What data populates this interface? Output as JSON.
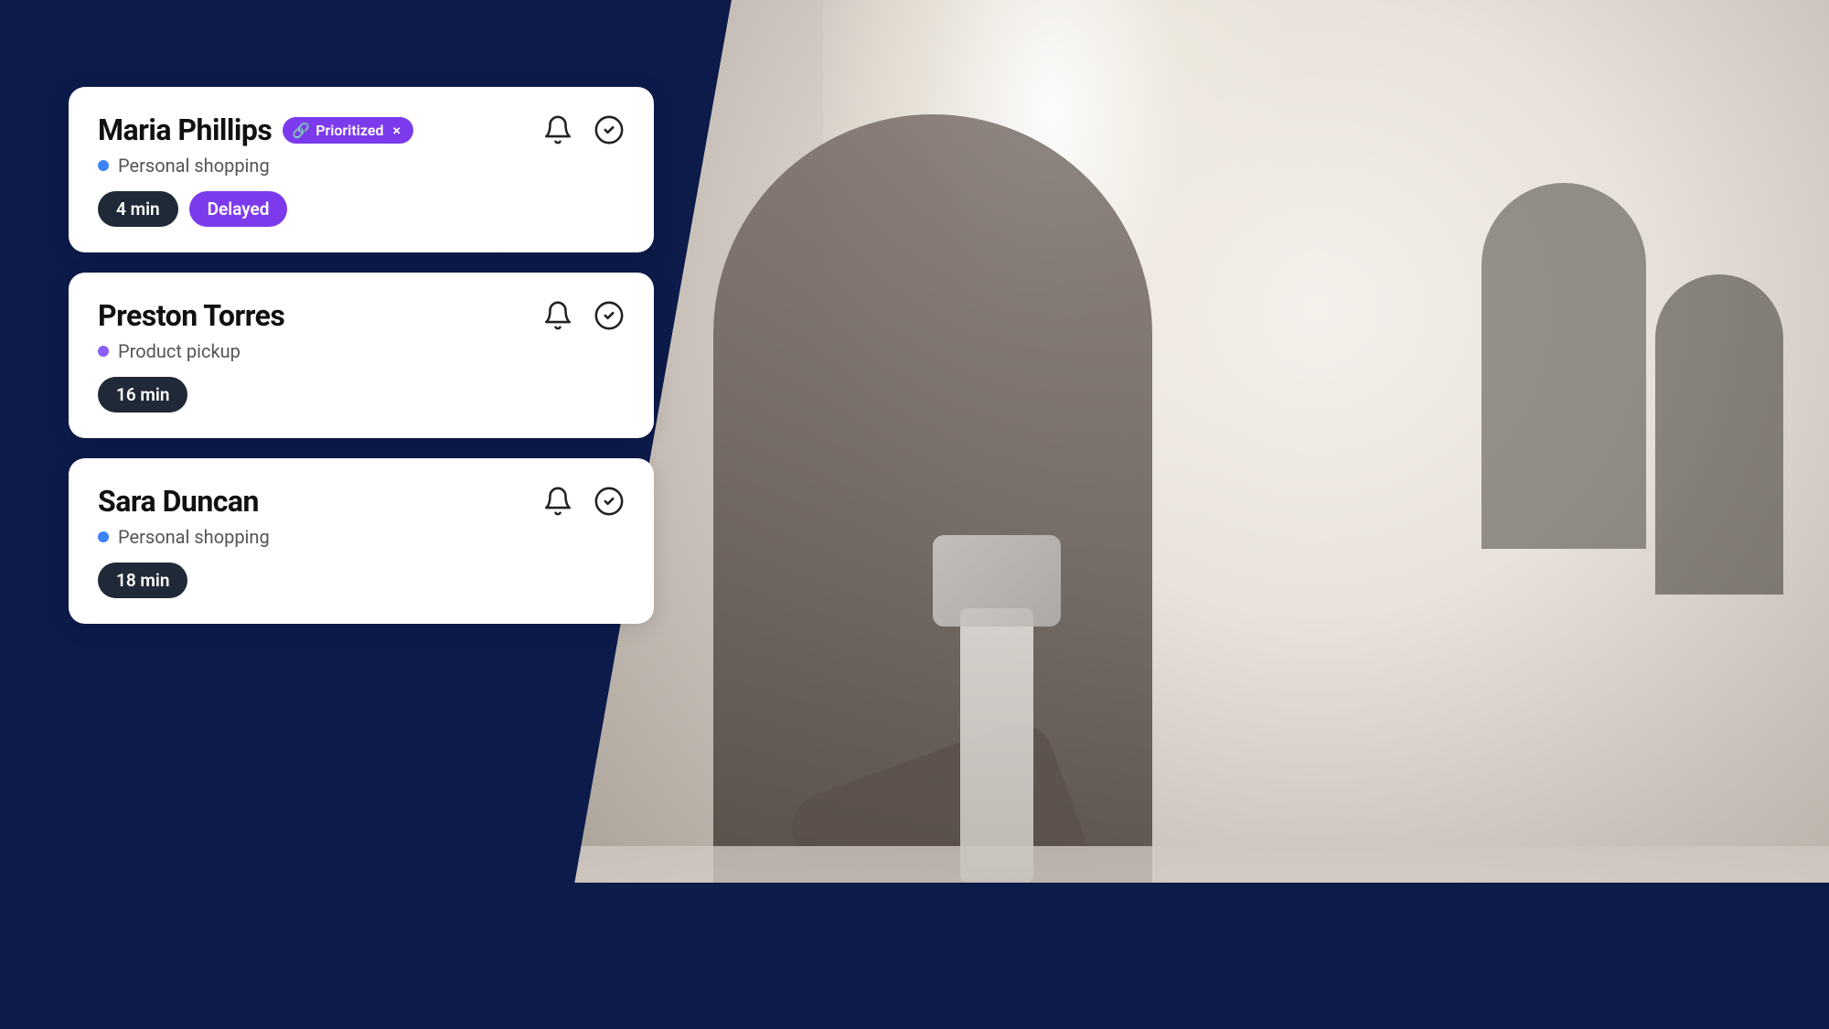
{
  "background": {
    "color": "#0d1b4b"
  },
  "cards": [
    {
      "id": "card-maria",
      "customer_name": "Maria Phillips",
      "prioritized": true,
      "prioritized_label": "Prioritized",
      "service": "Personal shopping",
      "service_dot": "blue",
      "time": "4 min",
      "delayed": true,
      "delayed_label": "Delayed"
    },
    {
      "id": "card-preston",
      "customer_name": "Preston Torres",
      "prioritized": false,
      "service": "Product pickup",
      "service_dot": "purple",
      "time": "16 min",
      "delayed": false
    },
    {
      "id": "card-sara",
      "customer_name": "Sara Duncan",
      "prioritized": false,
      "service": "Personal shopping",
      "service_dot": "blue",
      "time": "18 min",
      "delayed": false
    }
  ],
  "icons": {
    "bell": "🔔",
    "check_circle": "✅",
    "link": "🔗",
    "close": "×"
  }
}
